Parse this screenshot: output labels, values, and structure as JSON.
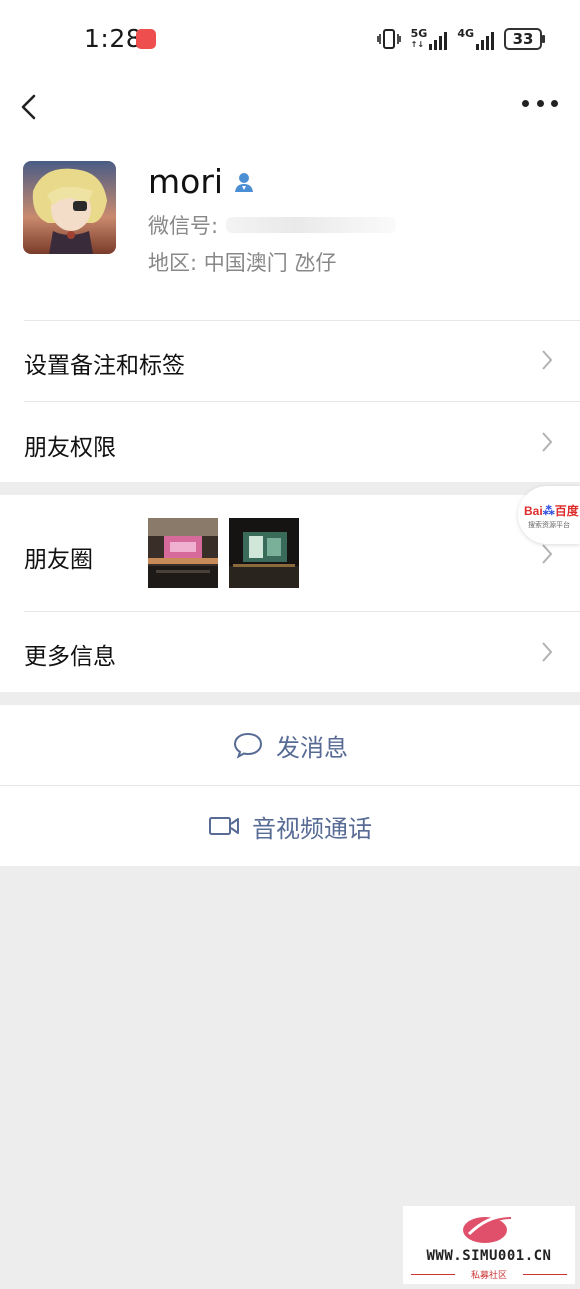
{
  "status_bar": {
    "time": "1:28",
    "network_5g": "5G",
    "network_4g": "4G",
    "battery": "33"
  },
  "profile": {
    "nickname": "mori",
    "wechat_id_label": "微信号:",
    "region": "地区:  中国澳门  氹仔"
  },
  "list": {
    "remark_tags": "设置备注和标签",
    "friend_permissions": "朋友权限",
    "moments": "朋友圈",
    "more_info": "更多信息"
  },
  "actions": {
    "send_message": "发消息",
    "video_call": "音视频通话"
  },
  "float_widget": {
    "brand": "Bai",
    "brand_cn": "百度",
    "subtitle": "搜索资源平台"
  },
  "watermark": {
    "url": "WWW.SIMU001.CN",
    "caption": "私募社区"
  },
  "colors": {
    "link_blue": "#576b95",
    "background": "#ededed",
    "verified_icon": "#4a8fd4"
  }
}
